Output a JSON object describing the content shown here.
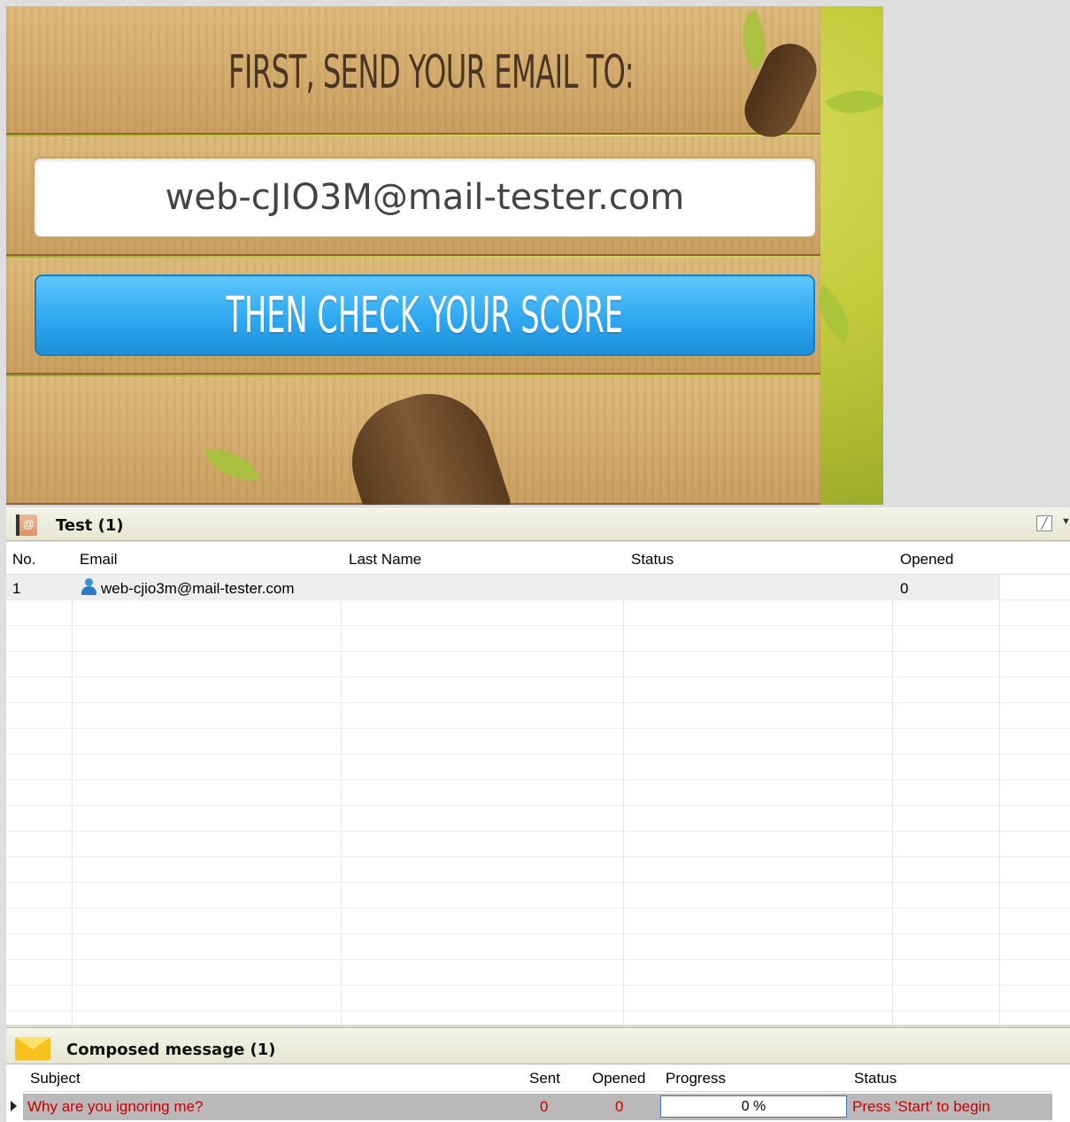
{
  "banner": {
    "headline": "First, send your email to:",
    "email": "web-cJIO3M@mail-tester.com",
    "cta_label": "Then check your score"
  },
  "contact_list": {
    "title": "Test (1)",
    "columns": [
      "No.",
      "Email",
      "Last Name",
      "Status",
      "Opened"
    ],
    "rows": [
      {
        "no": "1",
        "email": "web-cjio3m@mail-tester.com",
        "last_name": "",
        "status": "",
        "opened": "0"
      }
    ],
    "icons": {
      "list": "address-book-icon",
      "edit": "edit-icon",
      "dropdown": "chevron-down-icon",
      "contact": "person-icon"
    }
  },
  "composed": {
    "title": "Composed message (1)",
    "columns": [
      "Subject",
      "Sent",
      "Opened",
      "Progress",
      "Status"
    ],
    "rows": [
      {
        "subject": "Why are you ignoring me?",
        "sent": "0",
        "opened": "0",
        "progress_label": "0 %",
        "progress": 0,
        "status": "Press 'Start' to begin"
      }
    ],
    "icons": {
      "header": "envelope-icon",
      "current_row": "row-pointer-icon"
    }
  },
  "colors": {
    "cta_blue": "#2fa8f1",
    "error_red": "#c80000",
    "row_selected": "#b9b9b9"
  }
}
